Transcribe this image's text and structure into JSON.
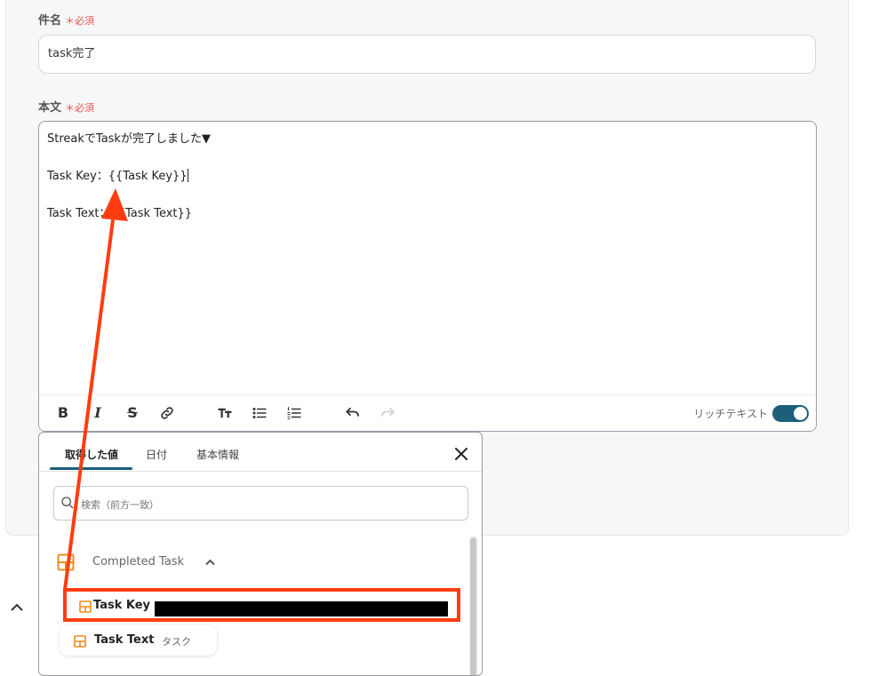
{
  "form": {
    "subject_label": "件名",
    "subject_required": "＊必須",
    "subject_value": "task完了",
    "body_label": "本文",
    "body_required": "＊必須",
    "body_lines": [
      "StreakでTaskが完了しました▼",
      "",
      "Task Key：{{Task Key}}",
      "",
      "Task Text：{{Task Text}}"
    ]
  },
  "toolbar": {
    "bold_icon": "B",
    "italic_icon": "I",
    "strike_icon": "S",
    "rich_text_label": "リッチテキスト",
    "rich_text_on": true
  },
  "popup": {
    "tabs": [
      "取得した値",
      "日付",
      "基本情報"
    ],
    "active_tab": 0,
    "search_placeholder": "検索（前方一致）",
    "group_label": "Completed Task",
    "items": [
      {
        "label": "Task Key",
        "value": "",
        "redacted": true
      },
      {
        "label": "Task Text",
        "value": "タスク",
        "redacted": false
      }
    ]
  },
  "colors": {
    "accent": "#1d5e7a",
    "required": "#e8544a",
    "highlight": "#ff3d10",
    "item_icon": "#f08a1d"
  }
}
